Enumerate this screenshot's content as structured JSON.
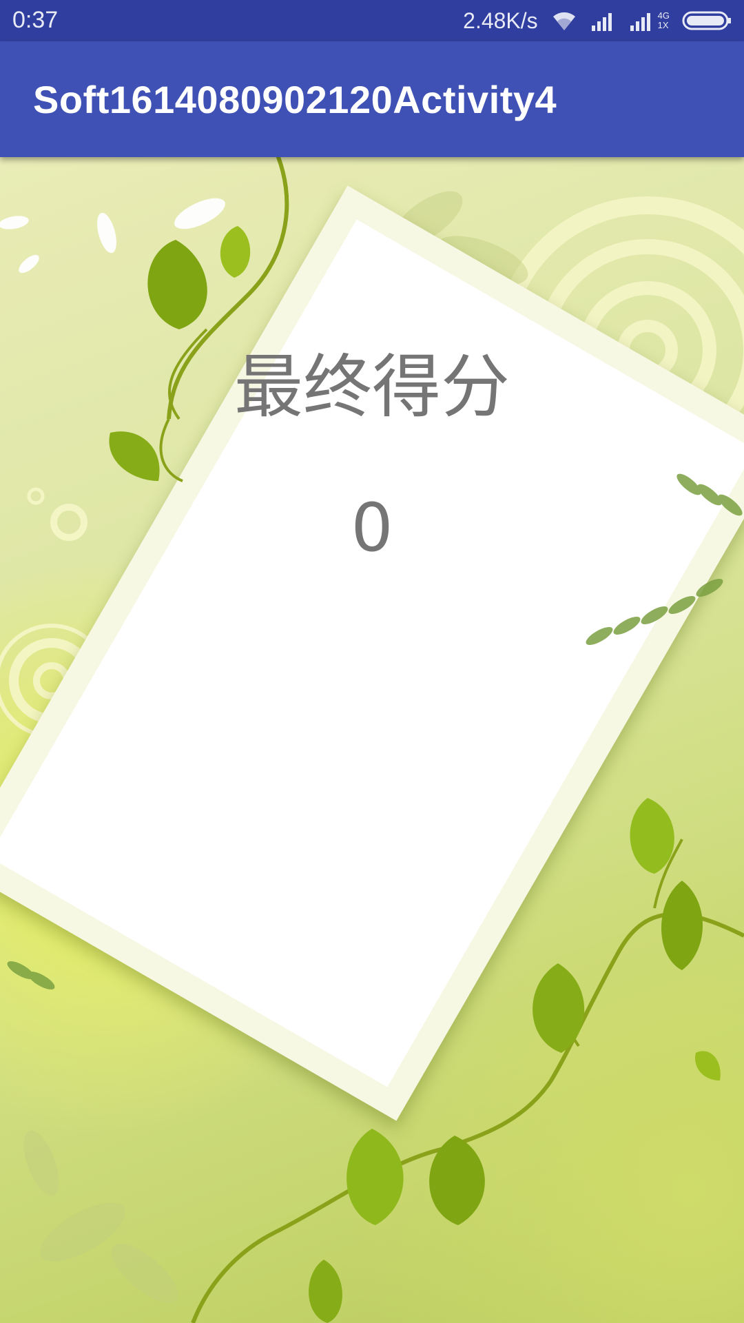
{
  "status_bar": {
    "time": "0:37",
    "network_speed": "2.48K/s",
    "icons": [
      "wifi-icon",
      "signal-icon",
      "signal-4g-icon",
      "battery-icon"
    ],
    "network_type_top": "4G",
    "network_type_bottom": "1X"
  },
  "app_bar": {
    "title": "Soft1614080902120Activity4"
  },
  "main": {
    "score_label": "最终得分",
    "score_value": "0"
  },
  "colors": {
    "status_bar": "#303f9f",
    "app_bar": "#3f51b5",
    "text_gray": "#757575"
  }
}
